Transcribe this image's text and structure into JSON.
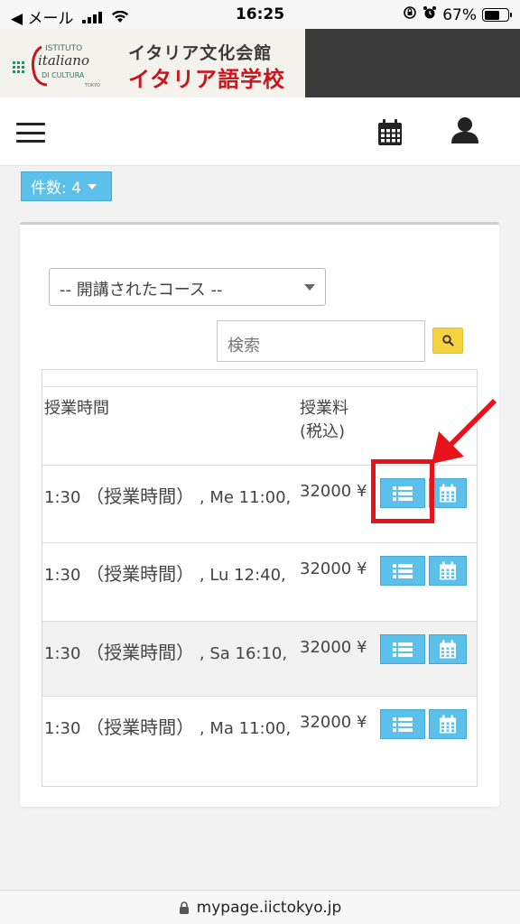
{
  "status_bar": {
    "back_label": "◀ メール",
    "time": "16:25",
    "battery": "67%",
    "battery_level": 0.67
  },
  "banner": {
    "logo_small_1": "ISTITUTO",
    "logo_small_2": "italiano",
    "logo_small_3": "DI CULTURA",
    "logo_small_4": "TOKYO",
    "title_1": "イタリア文化会館",
    "title_2": "イタリア語学校"
  },
  "header": {
    "menu_icon": "hamburger-icon",
    "calendar_icon": "calendar-icon",
    "user_icon": "user-icon"
  },
  "count_badge": {
    "label": "件数: 4"
  },
  "filter": {
    "select_value": "-- 開講されたコース --"
  },
  "search": {
    "placeholder": "検索"
  },
  "table": {
    "headers": {
      "time": "授業時間",
      "fee": "授業料",
      "fee_note": "(税込)"
    },
    "rows": [
      {
        "time_prefix": "1:30",
        "time_label": "（授業時間）",
        "time_suffix": ", Me 11:00,",
        "fee": "32000 ¥"
      },
      {
        "time_prefix": "1:30",
        "time_label": "（授業時間）",
        "time_suffix": ", Lu 12:40,",
        "fee": "32000 ¥"
      },
      {
        "time_prefix": "1:30",
        "time_label": "（授業時間）",
        "time_suffix": ", Sa 16:10,",
        "fee": "32000 ¥"
      },
      {
        "time_prefix": "1:30",
        "time_label": "（授業時間）",
        "time_suffix": ", Ma 11:00,",
        "fee": "32000 ¥"
      }
    ]
  },
  "url_bar": {
    "url": "mypage.iictokyo.jp"
  },
  "colors": {
    "accent_blue": "#5bc0ea",
    "search_yellow": "#f5d23f",
    "annotation_red": "#e8121a",
    "brand_red": "#c8161d"
  }
}
